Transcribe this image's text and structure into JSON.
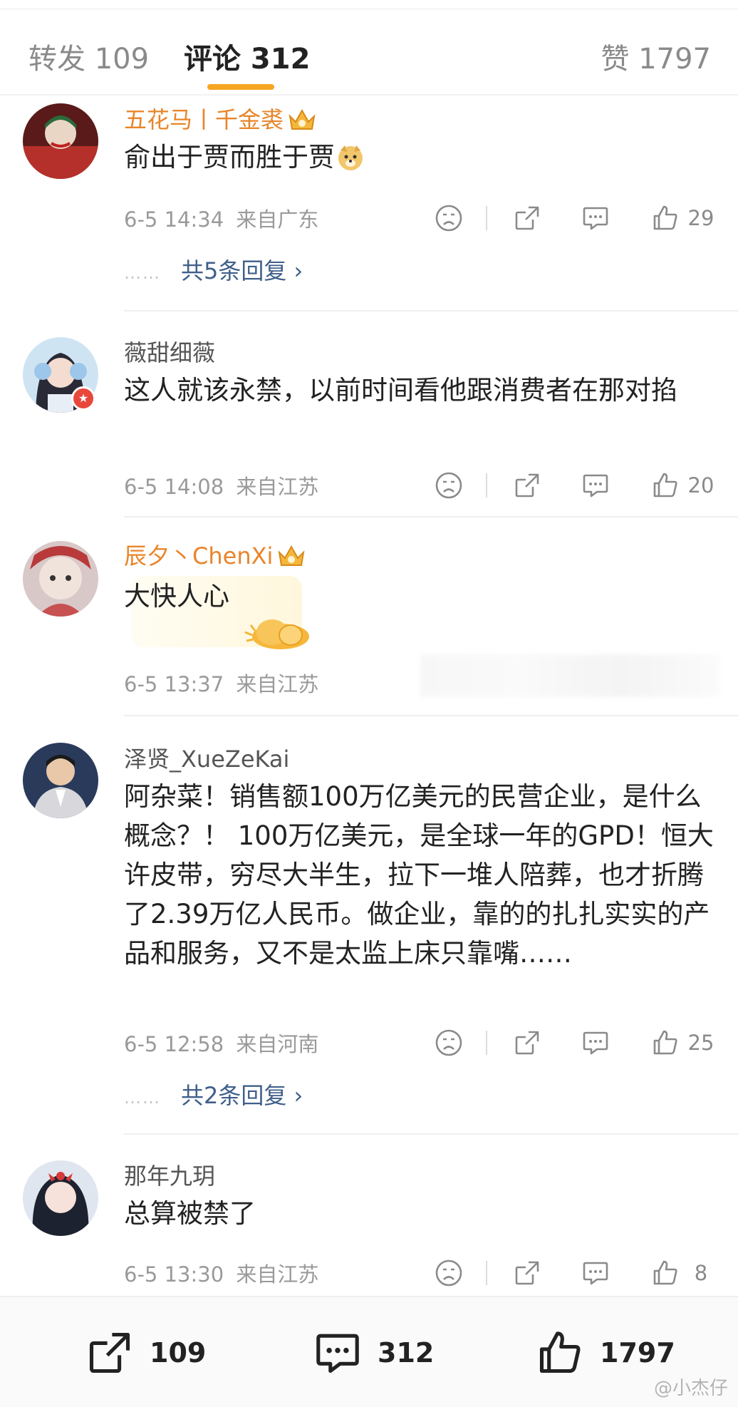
{
  "tabs": {
    "repost": "转发 109",
    "comment": "评论 312",
    "like": "赞 1797"
  },
  "comments": [
    {
      "username": "五花马丨千金裘",
      "content": "俞出于贾而胜于贾",
      "content_emoji": "doge-emoji",
      "time": "6-5 14:34",
      "location": "来自广东",
      "likes": "29",
      "replies": "共5条回复 ›"
    },
    {
      "username": "薇甜细薇",
      "content": "这人就该永禁，以前时间看他跟消费者在那对掐",
      "time": "6-5 14:08",
      "location": "来自江苏",
      "likes": "20"
    },
    {
      "username": "辰夕丶ChenXi",
      "content": "大快人心",
      "time": "6-5 13:37",
      "location": "来自江苏"
    },
    {
      "username": "泽贤_XueZeKai",
      "content": "阿杂菜！销售额100万亿美元的民营企业，是什么概念？！ 100万亿美元，是全球一年的GPD！恒大许皮带，穷尽大半生，拉下一堆人陪葬，也才折腾了2.39万亿人民币。做企业，靠的的扎扎实实的产品和服务，又不是太监上床只靠嘴……",
      "time": "6-5 12:58",
      "location": "来自河南",
      "likes": "25",
      "replies": "共2条回复 ›"
    },
    {
      "username": "那年九玥",
      "content": "总算被禁了",
      "time": "6-5 13:30",
      "location": "来自江苏",
      "likes": "8"
    }
  ],
  "bottom_bar": {
    "repost_count": "109",
    "comment_count": "312",
    "like_count": "1797"
  },
  "watermark": "@小杰仔",
  "colors": {
    "accent": "#f5a623",
    "vip_name": "#e8852a",
    "reply_link": "#3f5f8a",
    "meta_gray": "#9a9a9a"
  },
  "icons": {
    "dislike": "sad-face-icon",
    "repost": "share-arrow-icon",
    "comment": "comment-bubble-icon",
    "like": "thumbs-up-icon",
    "vip": "crown-icon"
  }
}
